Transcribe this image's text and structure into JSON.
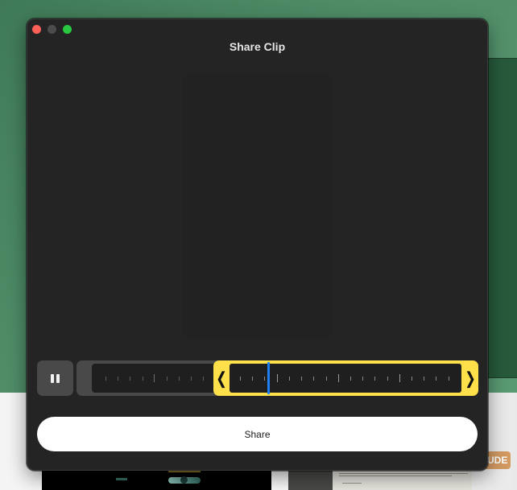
{
  "window": {
    "title": "Share Clip",
    "traffic_lights": [
      {
        "name": "close",
        "color": "#fe5f57"
      },
      {
        "name": "minimize",
        "color": "#4d4c4d"
      },
      {
        "name": "zoom",
        "color": "#29c840"
      }
    ]
  },
  "controls": {
    "pause_icon": "pause-icon",
    "trim_left_glyph": "❬",
    "trim_right_glyph": "❭",
    "selection_color": "#fee14a",
    "playhead_color": "#1e7ef2"
  },
  "share_button": {
    "label": "Share"
  },
  "background": {
    "badge_text": "UDE"
  }
}
